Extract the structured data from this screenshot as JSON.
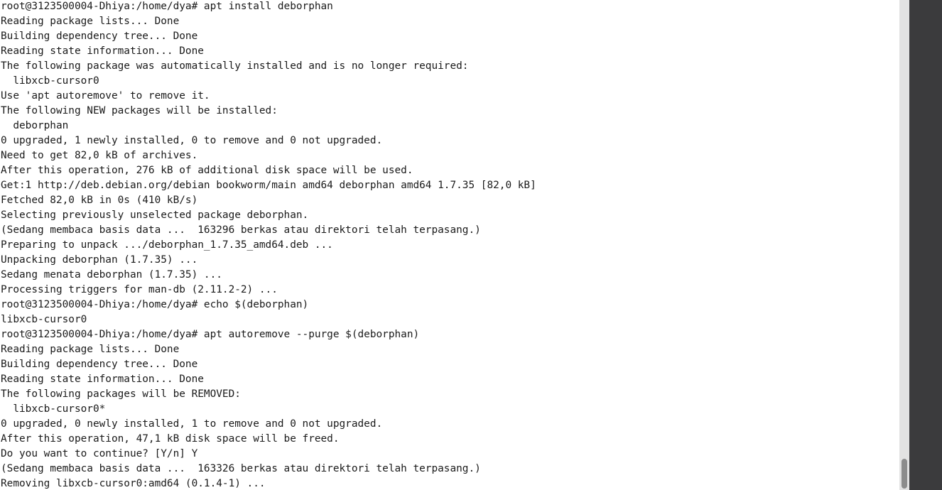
{
  "terminal": {
    "lines": [
      "root@3123500004-Dhiya:/home/dya# apt install deborphan",
      "Reading package lists... Done",
      "Building dependency tree... Done",
      "Reading state information... Done",
      "The following package was automatically installed and is no longer required:",
      "  libxcb-cursor0",
      "Use 'apt autoremove' to remove it.",
      "The following NEW packages will be installed:",
      "  deborphan",
      "0 upgraded, 1 newly installed, 0 to remove and 0 not upgraded.",
      "Need to get 82,0 kB of archives.",
      "After this operation, 276 kB of additional disk space will be used.",
      "Get:1 http://deb.debian.org/debian bookworm/main amd64 deborphan amd64 1.7.35 [82,0 kB]",
      "Fetched 82,0 kB in 0s (410 kB/s)",
      "Selecting previously unselected package deborphan.",
      "(Sedang membaca basis data ...  163296 berkas atau direktori telah terpasang.)",
      "Preparing to unpack .../deborphan_1.7.35_amd64.deb ...",
      "Unpacking deborphan (1.7.35) ...",
      "Sedang menata deborphan (1.7.35) ...",
      "Processing triggers for man-db (2.11.2-2) ...",
      "root@3123500004-Dhiya:/home/dya# echo $(deborphan)",
      "libxcb-cursor0",
      "root@3123500004-Dhiya:/home/dya# apt autoremove --purge $(deborphan)",
      "Reading package lists... Done",
      "Building dependency tree... Done",
      "Reading state information... Done",
      "The following packages will be REMOVED:",
      "  libxcb-cursor0*",
      "0 upgraded, 0 newly installed, 1 to remove and 0 not upgraded.",
      "After this operation, 47,1 kB disk space will be freed.",
      "Do you want to continue? [Y/n] Y",
      "(Sedang membaca basis data ...  163326 berkas atau direktori telah terpasang.)",
      "Removing libxcb-cursor0:amd64 (0.1.4-1) ..."
    ]
  },
  "colors": {
    "background": "#ffffff",
    "text": "#1a1a1a",
    "scrollbar_track": "#e2e2e2",
    "scrollbar_thumb": "#8c8c8c",
    "side_panel": "#3b3b3d"
  }
}
